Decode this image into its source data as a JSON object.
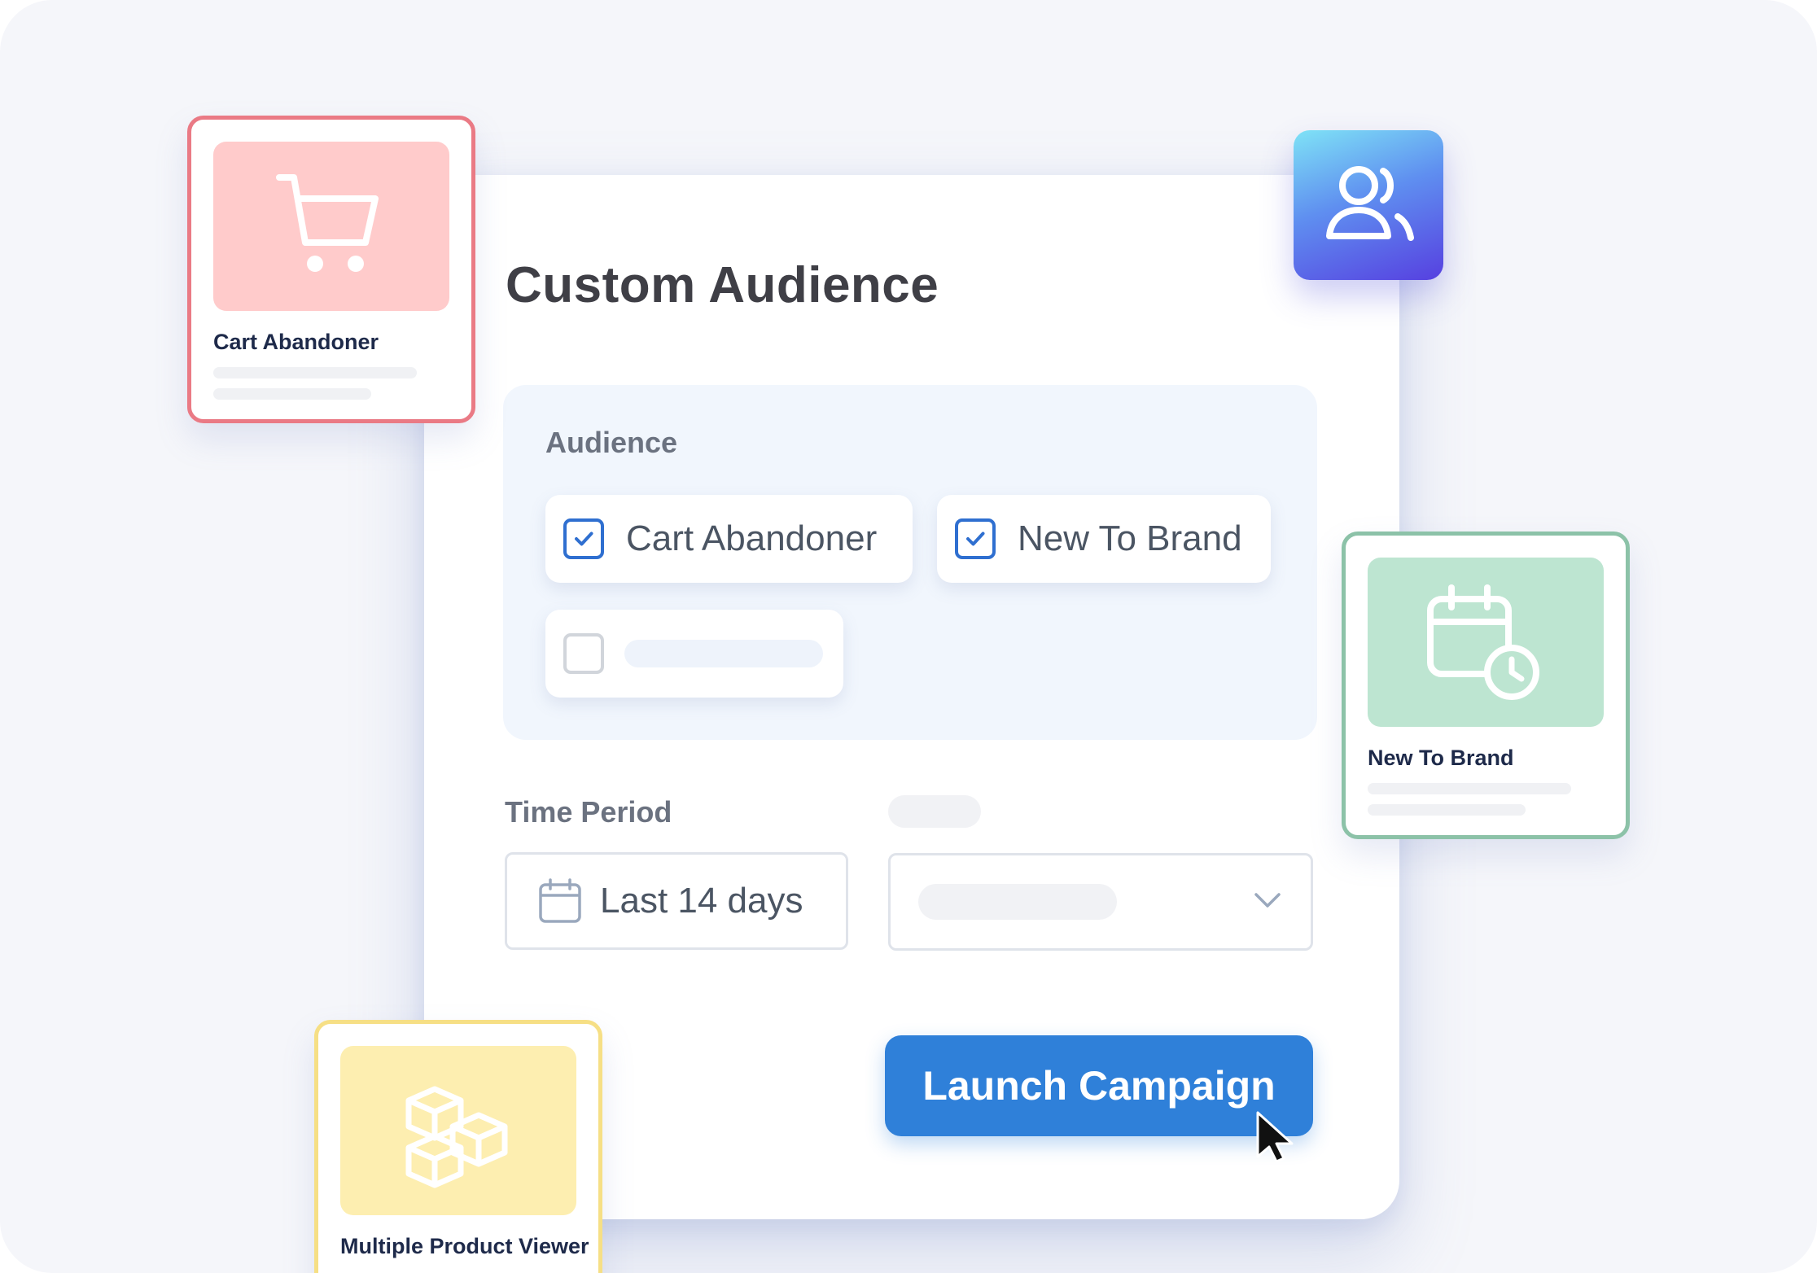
{
  "panel": {
    "title": "Custom Audience",
    "audience": {
      "label": "Audience",
      "options": [
        {
          "label": "Cart Abandoner",
          "checked": true
        },
        {
          "label": "New To Brand",
          "checked": true
        },
        {
          "label": "",
          "checked": false
        }
      ]
    },
    "time_period": {
      "label": "Time Period",
      "value": "Last 14 days",
      "icon": "calendar-icon"
    },
    "secondary_select": {
      "icon": "chevron-down-icon"
    },
    "launch_button": "Launch Campaign"
  },
  "cards": {
    "cart_abandoner": {
      "title": "Cart Abandoner",
      "icon": "shopping-cart-icon",
      "color": "#ffcbcb",
      "border": "#e85a66"
    },
    "new_to_brand": {
      "title": "New To Brand",
      "icon": "calendar-clock-icon",
      "color": "#bde5d1",
      "border": "#7bb79a"
    },
    "multiple_product_viewer": {
      "title": "Multiple Product Viewer",
      "icon": "boxes-icon",
      "color": "#fdeeb0",
      "border": "#f3d86a"
    }
  },
  "avatar_tile": {
    "icon": "users-icon"
  },
  "colors": {
    "accent": "#2f80d9",
    "checkbox": "#2f6fd0"
  }
}
